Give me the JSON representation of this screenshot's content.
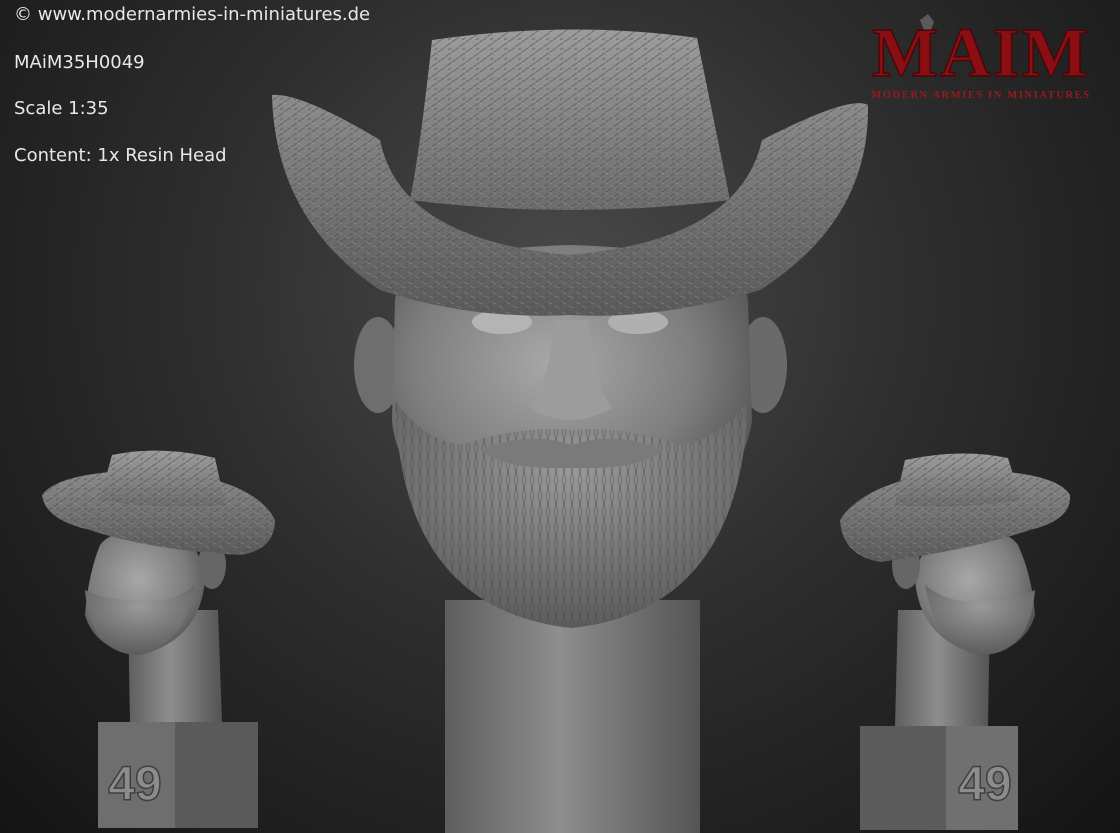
{
  "header": {
    "copyright": "© www.modernarmies-in-miniatures.de",
    "sku": "MAiM35H0049",
    "scale": "Scale 1:35",
    "content": "Content: 1x Resin Head"
  },
  "logo": {
    "mark": "MAIM",
    "tagline": "MODERN ARMIES IN MINIATURES",
    "color": "#8b0f12"
  },
  "bases": {
    "left_number": "49",
    "right_number": "49"
  },
  "colors": {
    "background": "#2e2e2e",
    "sculpt": "#8a8a8a"
  }
}
